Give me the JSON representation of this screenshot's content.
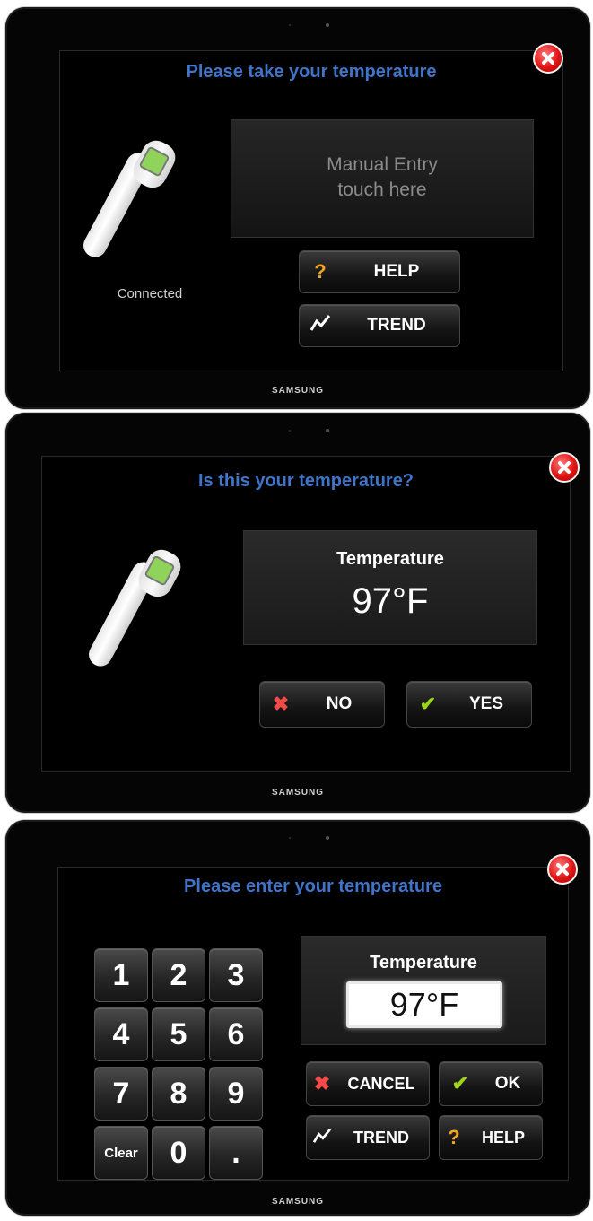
{
  "screen1": {
    "title": "Please take your temperature",
    "connection_status": "Connected",
    "manual_entry_line1": "Manual Entry",
    "manual_entry_line2": "touch here",
    "help_label": "HELP",
    "trend_label": "TREND",
    "brand": "SAMSUNG"
  },
  "screen2": {
    "title": "Is this your temperature?",
    "temp_label": "Temperature",
    "temp_value": "97°F",
    "no_label": "NO",
    "yes_label": "YES",
    "brand": "SAMSUNG"
  },
  "screen3": {
    "title": "Please enter your temperature",
    "keys": [
      "1",
      "2",
      "3",
      "4",
      "5",
      "6",
      "7",
      "8",
      "9",
      "Clear",
      "0",
      "."
    ],
    "temp_label": "Temperature",
    "temp_value": "97°F",
    "cancel_label": "CANCEL",
    "ok_label": "OK",
    "trend_label": "TREND",
    "help_label": "HELP",
    "brand": "SAMSUNG"
  },
  "icons": {
    "close": "close-icon",
    "help": "question-mark-icon",
    "trend": "trend-line-icon",
    "no": "x-icon",
    "yes": "check-icon"
  },
  "colors": {
    "title_blue": "#3f74c9",
    "close_red": "#e01515",
    "check_green": "#9ed61d",
    "help_orange": "#f5a623"
  }
}
